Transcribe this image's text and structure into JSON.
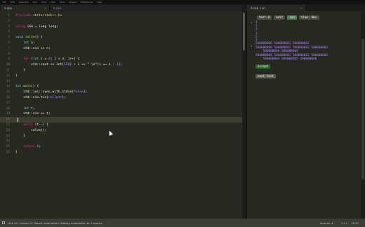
{
  "menubar": {
    "items": [
      "File",
      "Edit",
      "Selection",
      "Find",
      "View",
      "Goto",
      "Tools",
      "Project",
      "Preferences",
      "Help"
    ]
  },
  "tabs": {
    "editor_tab_1": "a.cpp",
    "editor_tab_2": "b.cpp",
    "output_tab": "A.cpp -run"
  },
  "editor": {
    "current_line": 20,
    "line_numbers": [
      "1",
      "2",
      "3",
      "4",
      "5",
      "6",
      "7",
      "8",
      "9",
      "10",
      "11",
      "12",
      "13",
      "14",
      "15",
      "16",
      "17",
      "18",
      "19",
      "20"
    ],
    "code_lines": [
      [
        {
          "t": "#include",
          "c": "kw"
        },
        {
          "t": " <bits/stdc++.h>",
          "c": "str"
        }
      ],
      [],
      [
        {
          "t": "using ",
          "c": "kw"
        },
        {
          "t": "i64 = long long;",
          "c": ""
        }
      ],
      [],
      [
        {
          "t": "void ",
          "c": "ty"
        },
        {
          "t": "solve",
          "c": "fn"
        },
        {
          "t": "() {",
          "c": ""
        }
      ],
      [
        {
          "t": "    int ",
          "c": "ty"
        },
        {
          "t": "n;",
          "c": ""
        }
      ],
      [
        {
          "t": "    std::cin >> n;",
          "c": ""
        }
      ],
      [],
      [
        {
          "t": "    for ",
          "c": "kw"
        },
        {
          "t": "(",
          "c": ""
        },
        {
          "t": "int ",
          "c": "ty"
        },
        {
          "t": "i = ",
          "c": ""
        },
        {
          "t": "0",
          "c": "num"
        },
        {
          "t": "; i < n; i++) {",
          "c": ""
        }
      ],
      [
        {
          "t": "        std::cout << int(",
          "c": ""
        },
        {
          "t": "5E8",
          "c": "num"
        },
        {
          "t": ") + i << \" \\n\"[i == n - ",
          "c": ""
        },
        {
          "t": "1",
          "c": "num"
        },
        {
          "t": "];",
          "c": ""
        }
      ],
      [
        {
          "t": "    }",
          "c": ""
        }
      ],
      [
        {
          "t": "}",
          "c": ""
        }
      ],
      [],
      [
        {
          "t": "int ",
          "c": "ty"
        },
        {
          "t": "main",
          "c": "fn"
        },
        {
          "t": "() {",
          "c": ""
        }
      ],
      [
        {
          "t": "    std::ios::sync_with_stdio(",
          "c": ""
        },
        {
          "t": "false",
          "c": "num"
        },
        {
          "t": ");",
          "c": ""
        }
      ],
      [
        {
          "t": "    std::cin.tie(",
          "c": ""
        },
        {
          "t": "nullptr",
          "c": "num"
        },
        {
          "t": ");",
          "c": ""
        }
      ],
      [],
      [
        {
          "t": "    int ",
          "c": "ty"
        },
        {
          "t": "t;",
          "c": ""
        }
      ],
      [
        {
          "t": "    std::cin >> t;",
          "c": ""
        }
      ],
      [],
      [
        {
          "t": "    while ",
          "c": "kw"
        },
        {
          "t": "(t--) {",
          "c": ""
        }
      ],
      [
        {
          "t": "        solve();",
          "c": ""
        }
      ],
      [
        {
          "t": "    }",
          "c": ""
        }
      ],
      [],
      [
        {
          "t": "    return ",
          "c": "kw"
        },
        {
          "t": "0",
          "c": "num"
        },
        {
          "t": ";",
          "c": ""
        }
      ],
      [
        {
          "t": "}",
          "c": ""
        }
      ]
    ]
  },
  "output": {
    "buttons": {
      "test": "test 0",
      "edit": "edit",
      "run": "run",
      "time": "time: 0ms"
    },
    "input_lines": [
      "3",
      "1",
      "2",
      "3",
      "5",
      "7"
    ],
    "collapse_top": "▾",
    "collapse_mid": "▾",
    "result_lines": [
      "500000000 500000001 500000002",
      "500000000 500000001 500000002 500000003",
      "    500000004 500000005",
      "500000000 500000001 500000002 500000003",
      "    500000004 500000005 500000006"
    ],
    "accept_label": "accept",
    "next_label": "next test"
  },
  "status": {
    "left_text": "Line 20, Column 2; Detect Indentation: Setting indentation to 4 spaces",
    "right_spaces": "Spaces: 4",
    "right_syntax": "C++",
    "clock": "19:57"
  }
}
